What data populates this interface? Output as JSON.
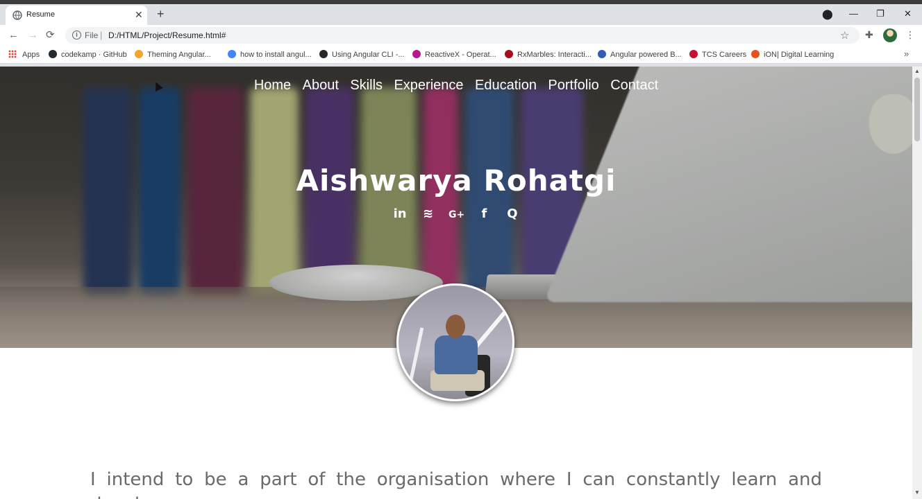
{
  "browser": {
    "tab_title": "Resume",
    "tab_close": "✕",
    "new_tab": "+",
    "url_scheme": "File",
    "url_separator": "|",
    "url": "D:/HTML/Project/Resume.html#",
    "window": {
      "account": "⬤",
      "minimize": "—",
      "restore": "❐",
      "close": "✕"
    },
    "nav": {
      "back": "←",
      "forward": "→",
      "reload": "⟳"
    },
    "star": "☆",
    "extensions": "✚",
    "menu": "⋮"
  },
  "bookmarks": [
    {
      "label": "Apps",
      "icon": "apps-grid-icon",
      "color": "#ea4335"
    },
    {
      "label": "codekamp · GitHub",
      "icon": "github-icon",
      "color": "#24292e"
    },
    {
      "label": "Theming Angular...",
      "icon": "shield-icon",
      "color": "#f4a52a"
    },
    {
      "label": "how to install angul...",
      "icon": "google-icon",
      "color": "#4285f4"
    },
    {
      "label": "Using Angular CLI -...",
      "icon": "github-icon",
      "color": "#24292e"
    },
    {
      "label": "ReactiveX - Operat...",
      "icon": "reactivex-icon",
      "color": "#b7178c"
    },
    {
      "label": "RxMarbles: Interacti...",
      "icon": "marble-icon",
      "color": "#a50e1a"
    },
    {
      "label": "Angular powered B...",
      "icon": "bootstrap-icon",
      "color": "#2c5fb4"
    },
    {
      "label": "TCS Careers",
      "icon": "tcs-icon",
      "color": "#c8102e"
    },
    {
      "label": "iON| Digital Learning",
      "icon": "power-icon",
      "color": "#e8501c"
    }
  ],
  "bookmarks_more": "»",
  "page": {
    "nav_links": [
      "Home",
      "About",
      "Skills",
      "Experience",
      "Education",
      "Portfolio",
      "Contact"
    ],
    "name": "Aishwarya Rohatgi",
    "social": [
      {
        "icon": "linkedin-icon",
        "glyph": "in"
      },
      {
        "icon": "stackoverflow-icon",
        "glyph": "≋"
      },
      {
        "icon": "google-plus-icon",
        "glyph": "G+"
      },
      {
        "icon": "facebook-icon",
        "glyph": "f"
      },
      {
        "icon": "quora-icon",
        "glyph": "Q"
      }
    ],
    "intro_text": "I intend to be a part of the organisation where I can constantly learn and develop"
  },
  "scroll": {
    "up": "▲",
    "down": "▼"
  }
}
